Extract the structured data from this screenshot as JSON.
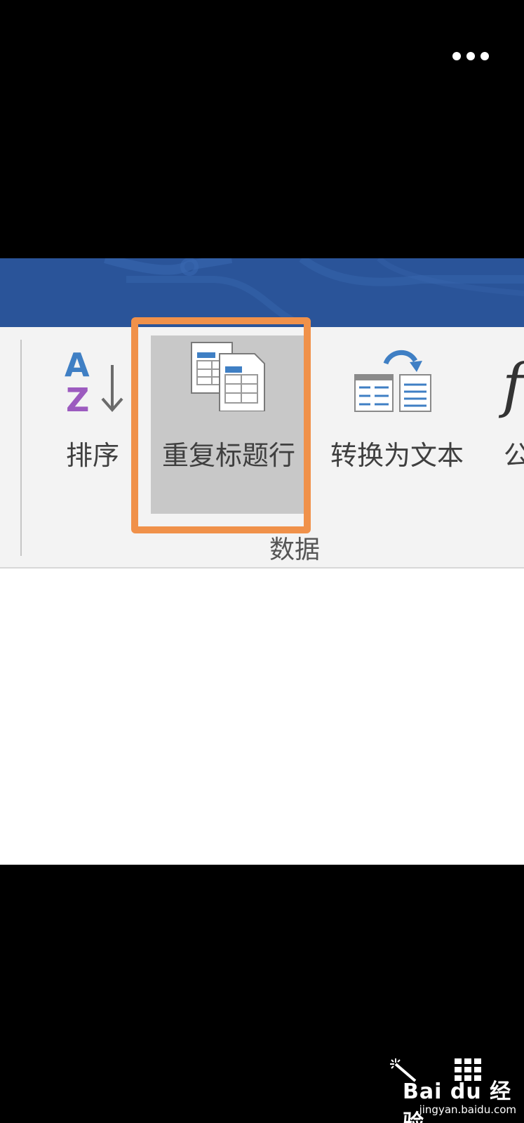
{
  "top_bar": {
    "more_icon": "more-horizontal-icon"
  },
  "ribbon": {
    "group_label": "数据",
    "commands": [
      {
        "label": "排序",
        "icon": "sort-az-icon"
      },
      {
        "label": "重复标题行",
        "icon": "repeat-header-rows-icon"
      },
      {
        "label": "转换为文本",
        "icon": "convert-to-text-icon"
      },
      {
        "label": "公",
        "icon": "formula-fx-icon"
      }
    ],
    "highlighted_command": "重复标题行"
  },
  "colors": {
    "title_bar": "#2a5499",
    "ribbon_bg": "#f3f3f3",
    "highlight_border": "#f0914a",
    "selected_bg": "#c8c8c8",
    "icon_blue": "#3f7fc4",
    "icon_purple": "#9c5bbf"
  },
  "watermark": {
    "logo_text": "Bai du 经验",
    "url": "jingyan.baidu.com"
  }
}
